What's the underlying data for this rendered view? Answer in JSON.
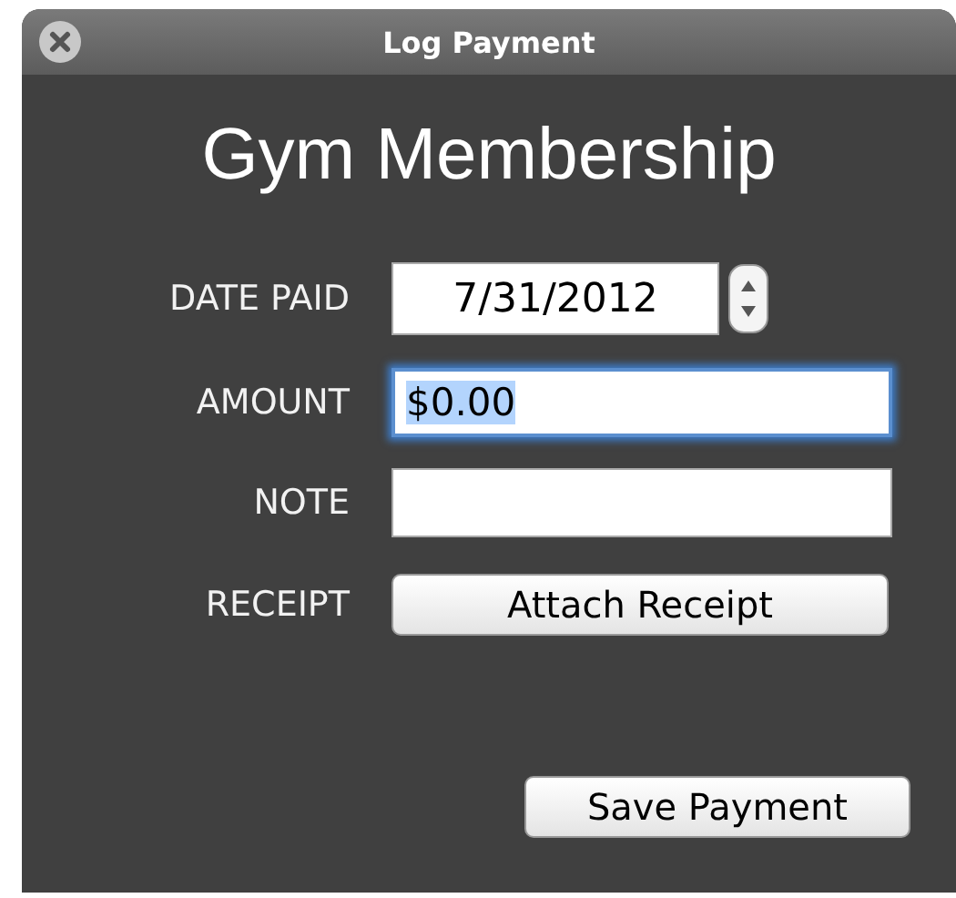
{
  "window": {
    "title": "Log Payment"
  },
  "heading": "Gym Membership",
  "rows": [
    {
      "kind": "date",
      "label": "DATE PAID",
      "value": "7/31/2012"
    },
    {
      "kind": "text",
      "label": "AMOUNT",
      "value": "$0.00",
      "focused": true
    },
    {
      "kind": "text",
      "label": "NOTE",
      "focused": false
    },
    {
      "kind": "button",
      "label": "RECEIPT",
      "value": "Attach Receipt"
    }
  ],
  "buttons": [
    "Save Payment"
  ]
}
